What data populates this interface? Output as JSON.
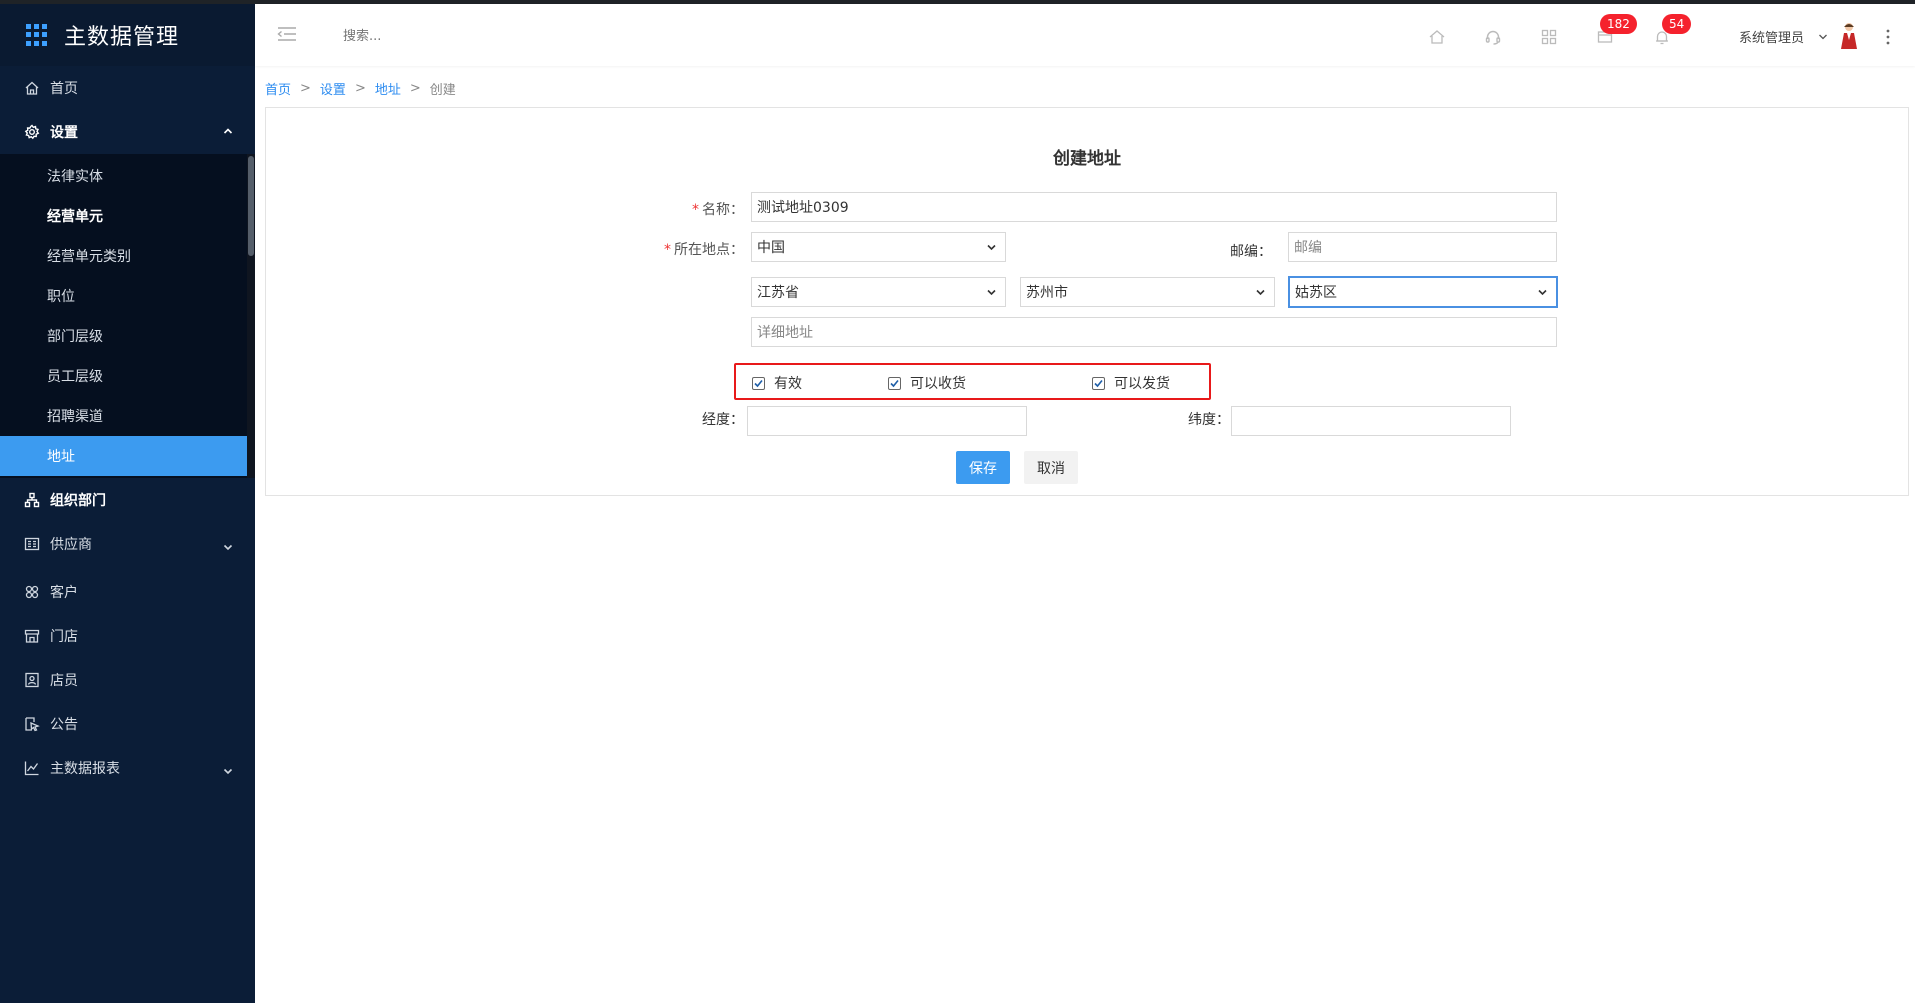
{
  "app": {
    "title": "主数据管理"
  },
  "sidebar": {
    "items": [
      {
        "label": "首页",
        "icon": "home-icon"
      },
      {
        "label": "设置",
        "icon": "gear-icon",
        "expanded": true,
        "children": [
          {
            "label": "法律实体"
          },
          {
            "label": "经营单元"
          },
          {
            "label": "经营单元类别"
          },
          {
            "label": "职位"
          },
          {
            "label": "部门层级"
          },
          {
            "label": "员工层级"
          },
          {
            "label": "招聘渠道"
          },
          {
            "label": "地址",
            "active": true
          }
        ]
      },
      {
        "label": "组织部门",
        "icon": "org-tree-icon"
      },
      {
        "label": "供应商",
        "icon": "supplier-icon"
      },
      {
        "label": "客户",
        "icon": "customer-icon"
      },
      {
        "label": "门店",
        "icon": "store-icon"
      },
      {
        "label": "店员",
        "icon": "staff-icon"
      },
      {
        "label": "公告",
        "icon": "announcement-icon"
      },
      {
        "label": "主数据报表",
        "icon": "chart-icon"
      }
    ]
  },
  "header": {
    "search_placeholder": "搜索...",
    "badges": {
      "messages": "182",
      "notifications": "54"
    },
    "user_name": "系统管理员"
  },
  "breadcrumb": {
    "home": "首页",
    "settings": "设置",
    "address": "地址",
    "current": "创建",
    "separator": ">"
  },
  "form": {
    "title": "创建地址",
    "name_label": "名称：",
    "name_value": "测试地址0309",
    "location_label": "所在地点：",
    "country_value": "中国",
    "postcode_label": "邮编：",
    "postcode_placeholder": "邮编",
    "province_value": "江苏省",
    "city_value": "苏州市",
    "district_value": "姑苏区",
    "detail_placeholder": "详细地址",
    "checkboxes": [
      {
        "label": "有效",
        "checked": true
      },
      {
        "label": "可以收货",
        "checked": true
      },
      {
        "label": "可以发货",
        "checked": true
      }
    ],
    "longitude_label": "经度：",
    "latitude_label": "纬度：",
    "save_label": "保存",
    "cancel_label": "取消"
  },
  "colors": {
    "accent": "#3c9bf0",
    "sidebar_bg": "#0b1d37",
    "badge": "#f5222d",
    "highlight": "#e8191a"
  }
}
